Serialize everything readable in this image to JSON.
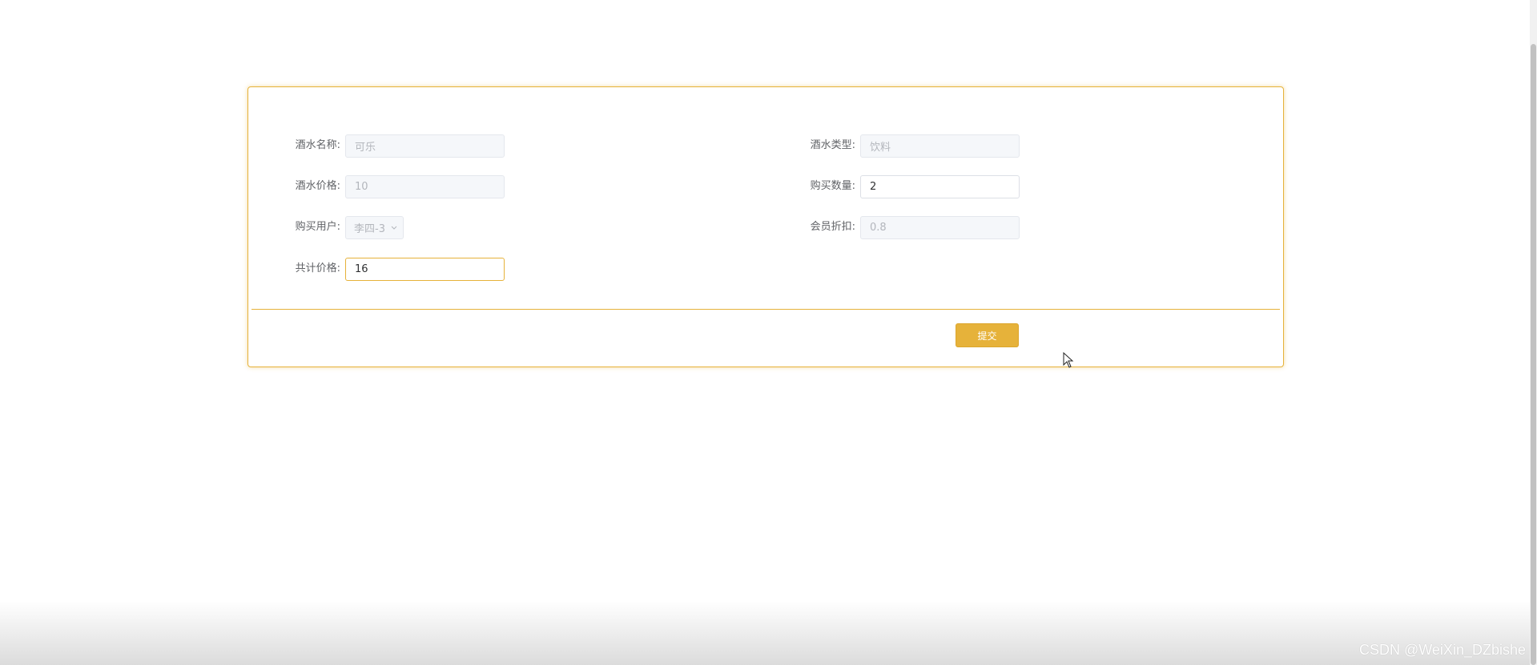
{
  "form": {
    "drink_name": {
      "label": "酒水名称:",
      "value": "可乐"
    },
    "drink_type": {
      "label": "酒水类型:",
      "value": "饮料"
    },
    "drink_price": {
      "label": "酒水价格:",
      "value": "10"
    },
    "purchase_qty": {
      "label": "购买数量:",
      "value": "2"
    },
    "purchase_user": {
      "label": "购买用户:",
      "value": "李四-3"
    },
    "member_discount": {
      "label": "会员折扣:",
      "value": "0.8"
    },
    "total_price": {
      "label": "共计价格:",
      "value": "16"
    }
  },
  "actions": {
    "submit_label": "提交"
  },
  "icons": {
    "select_arrow": "chevron-down-icon",
    "cursor": "mouse-pointer-icon"
  },
  "colors": {
    "accent": "#e6b23a",
    "disabled_bg": "#f5f7fa",
    "label": "#606266"
  },
  "watermark": "CSDN @WeiXin_DZbishe"
}
